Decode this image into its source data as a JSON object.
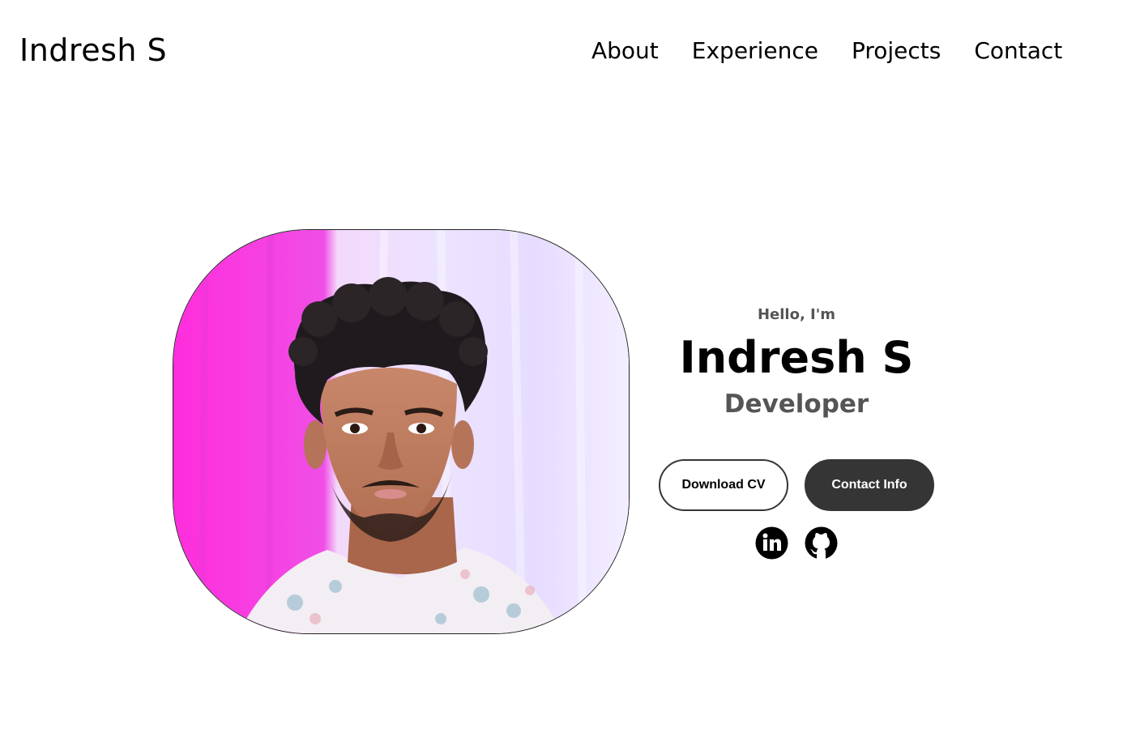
{
  "header": {
    "logo": "Indresh S",
    "nav": [
      {
        "label": "About"
      },
      {
        "label": "Experience"
      },
      {
        "label": "Projects"
      },
      {
        "label": "Contact"
      }
    ]
  },
  "hero": {
    "greeting": "Hello, I'm",
    "name": "Indresh S",
    "role": "Developer",
    "buttons": {
      "download_cv": "Download CV",
      "contact_info": "Contact Info"
    },
    "socials": [
      {
        "icon": "linkedin-icon"
      },
      {
        "icon": "github-icon"
      }
    ],
    "photo": {
      "icon": "profile-photo"
    }
  },
  "colors": {
    "text": "#000000",
    "muted": "#555555",
    "button_dark": "#353535",
    "photo_bg_left": "#ff3de0",
    "photo_bg_right": "#f1e8ff"
  }
}
